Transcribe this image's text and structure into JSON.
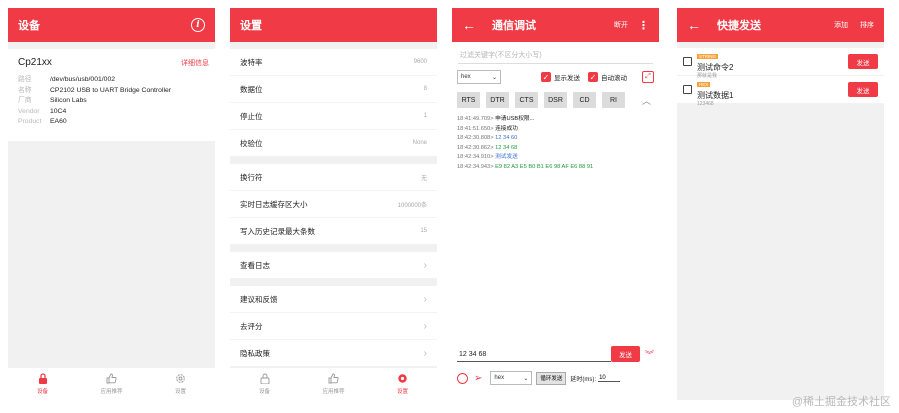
{
  "device": {
    "header_title": "设备",
    "info_glyph": "i",
    "name": "Cp21xx",
    "details_link": "详细信息",
    "fields": [
      {
        "k": "路径",
        "v": "/dev/bus/usb/001/002"
      },
      {
        "k": "名称",
        "v": "CP2102 USB to UART Bridge Controller"
      },
      {
        "k": "厂商",
        "v": "Silicon Labs"
      },
      {
        "k": "Vendor",
        "v": "10C4"
      },
      {
        "k": "Product",
        "v": "EA60"
      }
    ]
  },
  "nav": {
    "device": "设备",
    "recommend": "应用推荐",
    "settings": "设置"
  },
  "settings": {
    "header_title": "设置",
    "group1": [
      {
        "label": "波特率",
        "value": "9600"
      },
      {
        "label": "数据位",
        "value": "8"
      },
      {
        "label": "停止位",
        "value": "1"
      },
      {
        "label": "校验位",
        "value": "None"
      }
    ],
    "group2": [
      {
        "label": "换行符",
        "value": "无"
      },
      {
        "label": "实时日志缓存区大小",
        "value": "1000000条"
      },
      {
        "label": "写入历史记录最大条数",
        "value": "15"
      }
    ],
    "group3": [
      {
        "label": "查看日志"
      }
    ],
    "group4": [
      {
        "label": "建议和反馈"
      },
      {
        "label": "去评分"
      },
      {
        "label": "隐私政策"
      }
    ]
  },
  "comm": {
    "header_title": "通信调试",
    "disconnect": "断开",
    "filter_placeholder": "过滤关键字(不区分大小写)",
    "format": "hex",
    "show_send": "显示发送",
    "auto_scroll": "自动滚动",
    "signals": [
      "RTS",
      "DTR",
      "CTS",
      "DSR",
      "CD",
      "RI"
    ],
    "logs": [
      {
        "time": "18:41:49.709>",
        "msg": "申请USB权限...",
        "color": "black"
      },
      {
        "time": "18:41:51.650>",
        "msg": "连接成功",
        "color": "black"
      },
      {
        "time": "18:42:30.808>",
        "msg": "12 34 60",
        "color": "blue"
      },
      {
        "time": "18:42:30.862>",
        "msg": "12 34 68",
        "color": "green"
      },
      {
        "time": "18:42:34.910>",
        "msg": "测试发送",
        "color": "blue"
      },
      {
        "time": "18:42:34.943>",
        "msg": "E9 82 A3 E5 B0 B1 E6 98 AF E6 88 91",
        "color": "green"
      }
    ],
    "input_value": "12 34 68",
    "send": "发送",
    "bottom_format": "hex",
    "loop_send": "循环发送",
    "delay_label": "延时(ms):",
    "delay_value": "10"
  },
  "quick": {
    "header_title": "快捷发送",
    "add": "添加",
    "sort": "排序",
    "items": [
      {
        "tag": "STRING",
        "name": "测试命令2",
        "sub": "那就是我",
        "button": "发送"
      },
      {
        "tag": "HEX",
        "name": "测试数据1",
        "sub": "123468",
        "button": "发送"
      }
    ]
  },
  "watermark": "@稀土掘金技术社区",
  "colors": {
    "accent": "#f03a45",
    "tag": "#f6a23b",
    "panel_bg": "#f1f1f1"
  }
}
